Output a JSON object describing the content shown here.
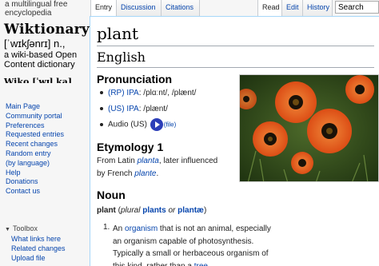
{
  "logo": {
    "tagline_top": "a multilingual free encyclopedia",
    "wordmark": "Wiktionary",
    "ipa": "[ˈwɪkʃənrɪ] n.,",
    "description": "a wiki-based Open Content dictionary",
    "cutoff": "Wiko [ˈwɪl ka]"
  },
  "sidebar": {
    "items": [
      {
        "label": "Main Page"
      },
      {
        "label": "Community portal"
      },
      {
        "label": "Preferences"
      },
      {
        "label": "Requested entries"
      },
      {
        "label": "Recent changes"
      },
      {
        "label": "Random entry"
      },
      {
        "label": "(by language)"
      },
      {
        "label": "Help"
      },
      {
        "label": "Donations"
      },
      {
        "label": "Contact us"
      }
    ],
    "toolbox_label": "Toolbox",
    "toolbox_items": [
      {
        "label": "What links here"
      },
      {
        "label": "Related changes"
      },
      {
        "label": "Upload file"
      }
    ]
  },
  "tabs": {
    "entry": "Entry",
    "discussion": "Discussion",
    "citations": "Citations",
    "read": "Read",
    "edit": "Edit",
    "history": "History"
  },
  "search": {
    "value": "Search"
  },
  "article": {
    "title": "plant",
    "language": "English",
    "pronunciation_heading": "Pronunciation",
    "pron_lines": [
      {
        "accent": "(RP)",
        "ipa_label": "IPA",
        "transcription": ": /plɑːnt/, /plænt/"
      },
      {
        "accent": "(US)",
        "ipa_label": "IPA",
        "transcription": ": /plænt/"
      }
    ],
    "audio_label": "Audio (US)",
    "audio_file_label": "(file)",
    "etymology_heading": "Etymology 1",
    "etymology_line1_pre": "From Latin ",
    "etymology_latin": "planta",
    "etymology_line1_post": ", later influenced",
    "etymology_line2_pre": "by French ",
    "etymology_french": "plante",
    "etymology_line2_post": ".",
    "noun_heading": "Noun",
    "headword": "plant",
    "plural_open": " (",
    "plural_label": "plural",
    "plural_form1": "plants",
    "plural_or": " or ",
    "plural_form2": "plantæ",
    "plural_close": ")",
    "def_number": "1.",
    "def_pre": "An ",
    "def_link1": "organism",
    "def_mid": " that is not an animal, especially an organism capable of photosynthesis. Typically a small or herbaceous organism of this kind, rather than a ",
    "def_link2": "tree",
    "def_end": "."
  },
  "colors": {
    "link": "#0645ad",
    "flower_orange": "#e8551a",
    "flower_center": "#1a1208",
    "audio_button": "#2c3eb8"
  }
}
